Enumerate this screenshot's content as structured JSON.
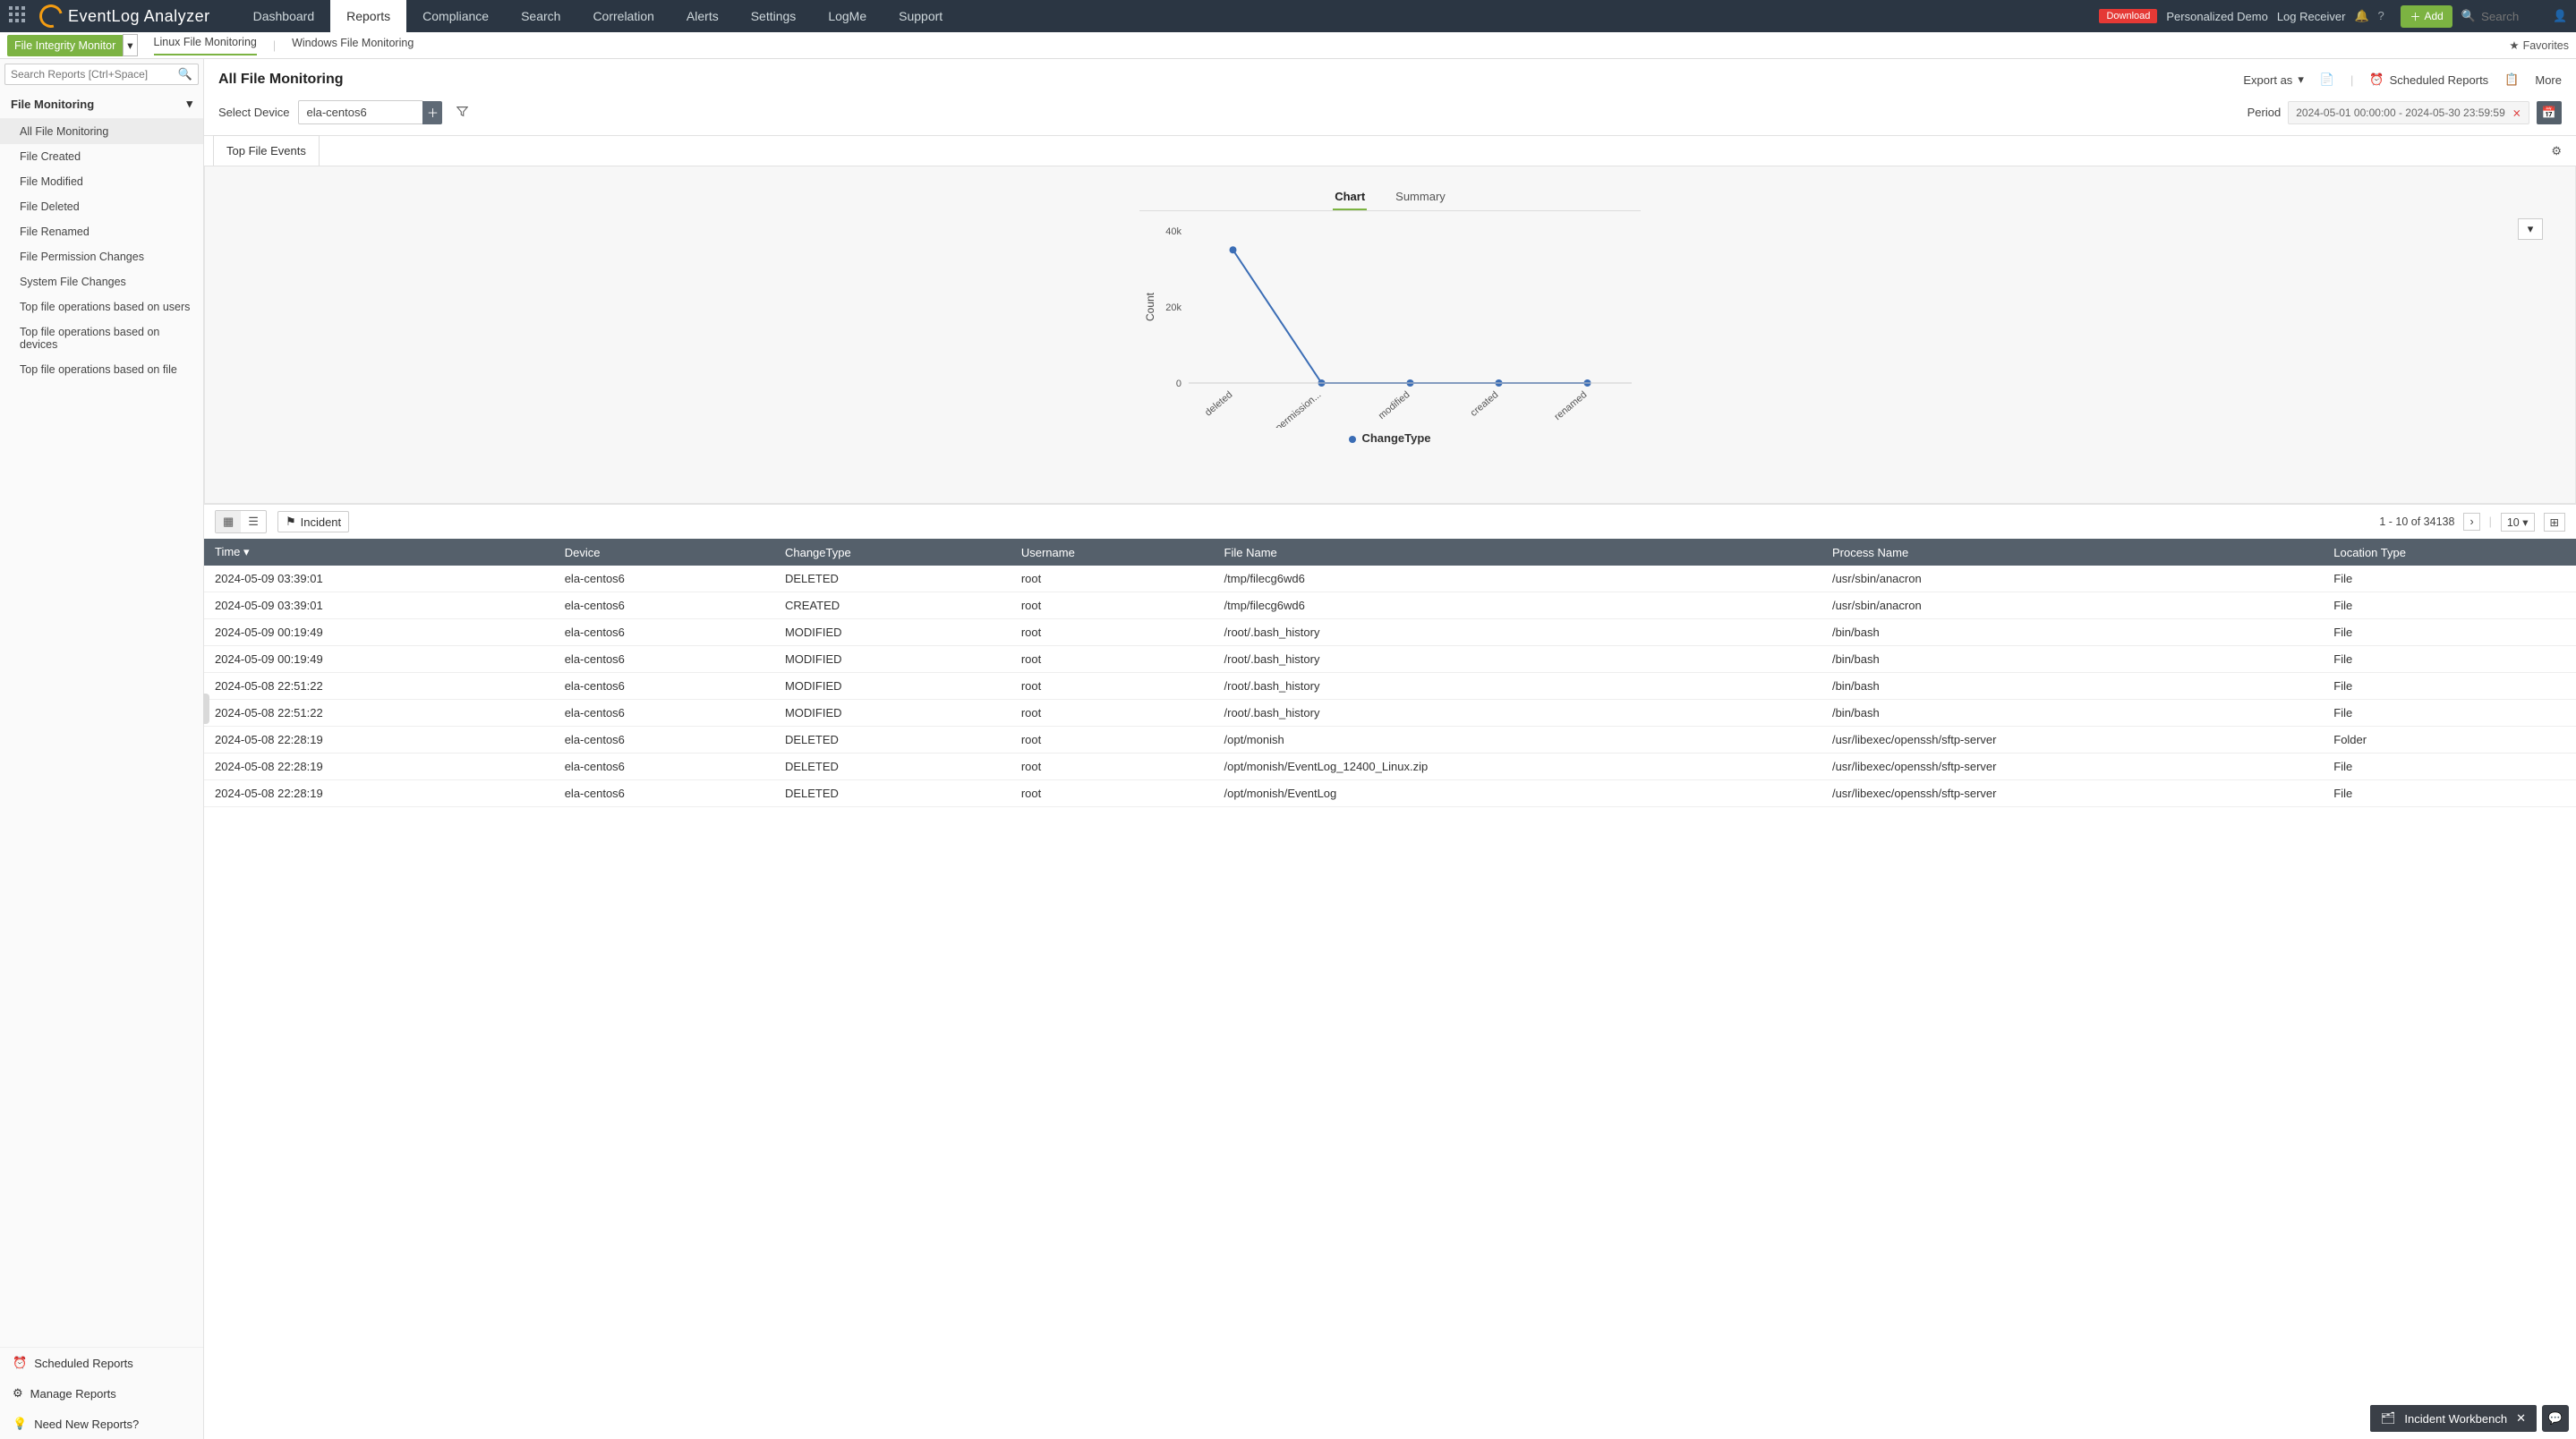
{
  "topbar": {
    "brand_a": "EventLog",
    "brand_b": "Analyzer",
    "nav": [
      "Dashboard",
      "Reports",
      "Compliance",
      "Search",
      "Correlation",
      "Alerts",
      "Settings",
      "LogMe",
      "Support"
    ],
    "nav_active": "Reports",
    "download": "Download",
    "demo": "Personalized Demo",
    "logrec": "Log Receiver",
    "add": "Add",
    "search_placeholder": "Search"
  },
  "subbar": {
    "fim": "File Integrity Monitor",
    "linux": "Linux File Monitoring",
    "windows": "Windows File Monitoring",
    "favorites": "Favorites"
  },
  "sidebar": {
    "search_placeholder": "Search Reports [Ctrl+Space]",
    "section": "File Monitoring",
    "items": [
      "All File Monitoring",
      "File Created",
      "File Modified",
      "File Deleted",
      "File Renamed",
      "File Permission Changes",
      "System File Changes",
      "Top file operations based on users",
      "Top file operations based on devices",
      "Top file operations based on file"
    ],
    "scheduled": "Scheduled Reports",
    "manage": "Manage Reports",
    "need_new": "Need New Reports?"
  },
  "main": {
    "title": "All File Monitoring",
    "export_as": "Export as",
    "scheduled": "Scheduled Reports",
    "more": "More",
    "select_device": "Select Device",
    "device_value": "ela-centos6",
    "period_label": "Period",
    "period_value": "2024-05-01 00:00:00 - 2024-05-30 23:59:59",
    "tab_top_file": "Top File Events",
    "chart_tab_chart": "Chart",
    "chart_tab_summary": "Summary",
    "legend": "ChangeType"
  },
  "chart_data": {
    "type": "line",
    "title": "",
    "xlabel": "",
    "ylabel": "Count",
    "categories": [
      "deleted",
      "permission...",
      "modified",
      "created",
      "renamed"
    ],
    "values": [
      35000,
      0,
      0,
      0,
      0
    ],
    "ylim": [
      0,
      40000
    ],
    "yticks": [
      0,
      20000,
      40000
    ],
    "ytick_labels": [
      "0",
      "20k",
      "40k"
    ]
  },
  "table": {
    "incident": "Incident",
    "page_info": "1 - 10 of 34138",
    "page_size": "10",
    "columns": [
      "Time",
      "Device",
      "ChangeType",
      "Username",
      "File Name",
      "Process Name",
      "Location Type"
    ],
    "rows": [
      [
        "2024-05-09 03:39:01",
        "ela-centos6",
        "DELETED",
        "root",
        "/tmp/filecg6wd6",
        "/usr/sbin/anacron",
        "File"
      ],
      [
        "2024-05-09 03:39:01",
        "ela-centos6",
        "CREATED",
        "root",
        "/tmp/filecg6wd6",
        "/usr/sbin/anacron",
        "File"
      ],
      [
        "2024-05-09 00:19:49",
        "ela-centos6",
        "MODIFIED",
        "root",
        "/root/.bash_history",
        "/bin/bash",
        "File"
      ],
      [
        "2024-05-09 00:19:49",
        "ela-centos6",
        "MODIFIED",
        "root",
        "/root/.bash_history",
        "/bin/bash",
        "File"
      ],
      [
        "2024-05-08 22:51:22",
        "ela-centos6",
        "MODIFIED",
        "root",
        "/root/.bash_history",
        "/bin/bash",
        "File"
      ],
      [
        "2024-05-08 22:51:22",
        "ela-centos6",
        "MODIFIED",
        "root",
        "/root/.bash_history",
        "/bin/bash",
        "File"
      ],
      [
        "2024-05-08 22:28:19",
        "ela-centos6",
        "DELETED",
        "root",
        "/opt/monish",
        "/usr/libexec/openssh/sftp-server",
        "Folder"
      ],
      [
        "2024-05-08 22:28:19",
        "ela-centos6",
        "DELETED",
        "root",
        "/opt/monish/EventLog_12400_Linux.zip",
        "/usr/libexec/openssh/sftp-server",
        "File"
      ],
      [
        "2024-05-08 22:28:19",
        "ela-centos6",
        "DELETED",
        "root",
        "/opt/monish/EventLog",
        "/usr/libexec/openssh/sftp-server",
        "File"
      ]
    ]
  },
  "incident_wb": {
    "label": "Incident Workbench"
  }
}
